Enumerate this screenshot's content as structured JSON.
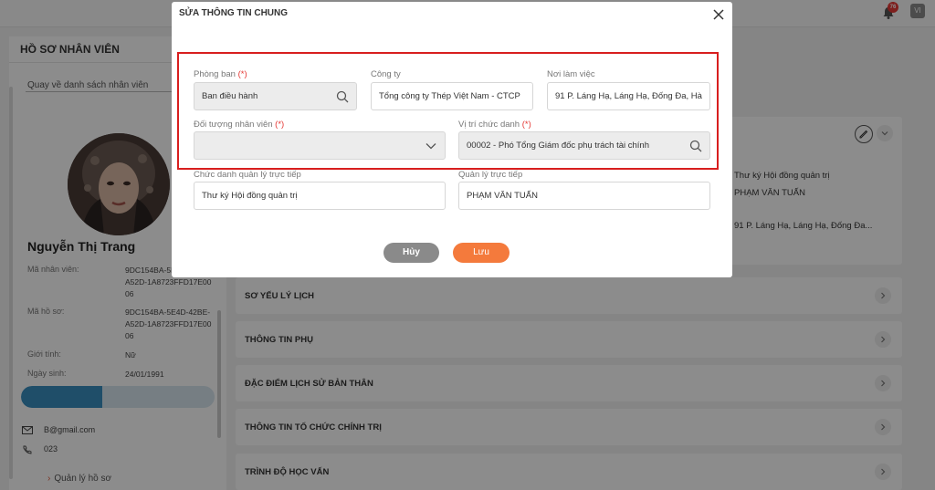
{
  "topbar": {
    "notification_count": "76",
    "user_initials": "VI"
  },
  "left_panel": {
    "title": "HỒ SƠ NHÂN VIÊN",
    "back_link": "Quay về danh sách nhân viên",
    "employee_name": "Nguyễn Thị Trang",
    "fields": [
      {
        "label": "Mã nhân viên:",
        "value": "9DC154BA-5E4D-42BE-A52D-1A8723FFD17E0006"
      },
      {
        "label": "Mã hồ sơ:",
        "value": "9DC154BA-5E4D-42BE-A52D-1A8723FFD17E0006"
      },
      {
        "label": "Giới tính:",
        "value": "Nữ"
      },
      {
        "label": "Ngày sinh:",
        "value": "24/01/1991"
      }
    ],
    "progress_fraction": 0.42,
    "email": "B@gmail.com",
    "phone": "023",
    "menu_link": "Quản lý hồ sơ"
  },
  "background_info": {
    "manager_title": "Thư ký Hội đồng quản trị",
    "manager_name": "PHẠM VĂN TUẤN",
    "address": "91 P. Láng Hạ, Láng Hạ, Đống Đa..."
  },
  "sections": [
    {
      "label": "SƠ YẾU LÝ LỊCH"
    },
    {
      "label": "THÔNG TIN PHỤ"
    },
    {
      "label": "ĐẶC ĐIỂM LỊCH SỬ BẢN THÂN"
    },
    {
      "label": "THÔNG TIN TỔ CHỨC CHÍNH TRỊ"
    },
    {
      "label": "TRÌNH ĐỘ HỌC VẤN"
    }
  ],
  "modal": {
    "title": "SỬA THÔNG TIN CHUNG",
    "required_mark": "(*)",
    "fields": {
      "department": {
        "label": "Phòng ban",
        "value": "Ban điều hành"
      },
      "company": {
        "label": "Công ty",
        "value": "Tổng công ty Thép Việt Nam - CTCP"
      },
      "workplace": {
        "label": "Nơi làm việc",
        "value": "91 P. Láng Hạ, Láng Hạ, Đống Đa, Hà"
      },
      "employee_type": {
        "label": "Đối tượng nhân viên",
        "value": ""
      },
      "position": {
        "label": "Vị trí chức danh",
        "value": "00002 - Phó Tổng Giám đốc phụ trách tài chính"
      },
      "manager_title": {
        "label": "Chức danh quản lý trực tiếp",
        "value": "Thư ký Hội đồng quản trị"
      },
      "direct_manager": {
        "label": "Quản lý trực tiếp",
        "value": "PHẠM VĂN TUẤN"
      }
    },
    "cancel_label": "Hủy",
    "save_label": "Lưu"
  },
  "colors": {
    "accent": "#f47a3c",
    "required": "#e53935",
    "highlight": "#d81e1e",
    "progress": "#3a8fbf"
  }
}
